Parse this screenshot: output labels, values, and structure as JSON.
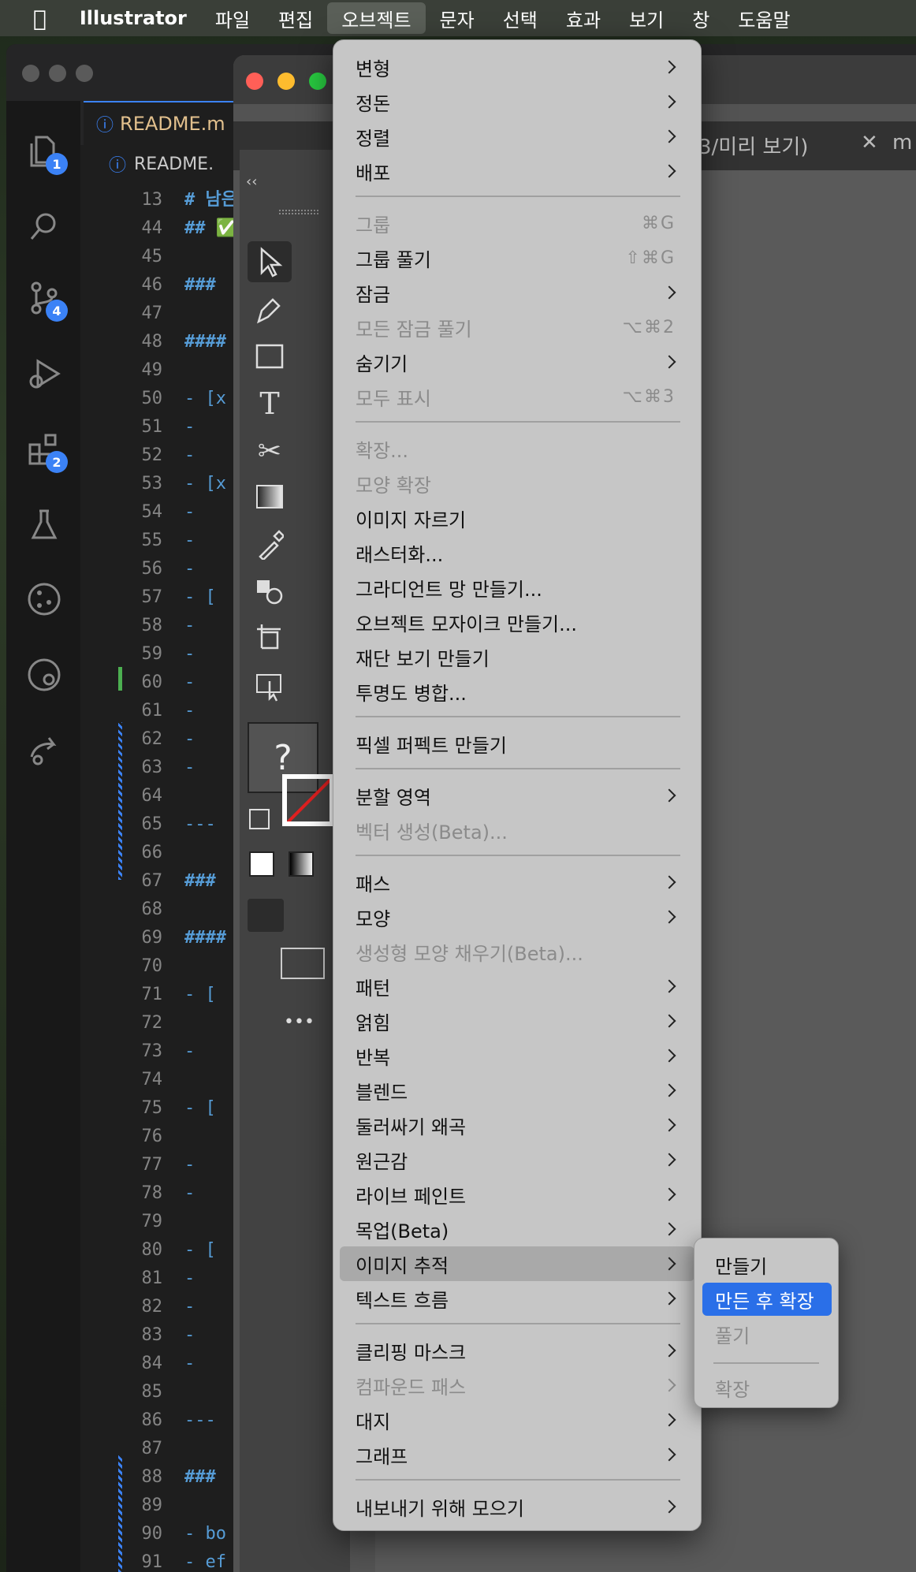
{
  "menubar": {
    "app_name": "Illustrator",
    "items": [
      "파일",
      "편집",
      "오브젝트",
      "문자",
      "선택",
      "효과",
      "보기",
      "창",
      "도움말"
    ],
    "active_index": 2
  },
  "vscode": {
    "tab_label": "README.m",
    "breadcrumb": "README.",
    "preview_tab": "3/미리 보기)",
    "close_tab": "m",
    "badges": {
      "explorer": "1",
      "scm": "4",
      "extensions": "2"
    },
    "lines": [
      {
        "n": "13",
        "t": "# 남은"
      },
      {
        "n": "44",
        "t": "## ✅"
      },
      {
        "n": "45",
        "t": ""
      },
      {
        "n": "46",
        "t": "###"
      },
      {
        "n": "47",
        "t": ""
      },
      {
        "n": "48",
        "t": "####"
      },
      {
        "n": "49",
        "t": ""
      },
      {
        "n": "50",
        "t": "- [x"
      },
      {
        "n": "51",
        "t": "  -"
      },
      {
        "n": "52",
        "t": "  -"
      },
      {
        "n": "53",
        "t": "- [x"
      },
      {
        "n": "54",
        "t": "  -"
      },
      {
        "n": "55",
        "t": "  -"
      },
      {
        "n": "56",
        "t": "  -"
      },
      {
        "n": "57",
        "t": "- ["
      },
      {
        "n": "58",
        "t": "  -"
      },
      {
        "n": "59",
        "t": "  -"
      },
      {
        "n": "60",
        "t": "  -"
      },
      {
        "n": "61",
        "t": "  -"
      },
      {
        "n": "62",
        "t": "  -"
      },
      {
        "n": "63",
        "t": "  -"
      },
      {
        "n": "64",
        "t": ""
      },
      {
        "n": "65",
        "t": "---"
      },
      {
        "n": "66",
        "t": ""
      },
      {
        "n": "67",
        "t": "###"
      },
      {
        "n": "68",
        "t": ""
      },
      {
        "n": "69",
        "t": "####"
      },
      {
        "n": "70",
        "t": ""
      },
      {
        "n": "71",
        "t": "- ["
      },
      {
        "n": "72",
        "t": ""
      },
      {
        "n": "73",
        "t": "  -"
      },
      {
        "n": "74",
        "t": ""
      },
      {
        "n": "75",
        "t": "- ["
      },
      {
        "n": "76",
        "t": ""
      },
      {
        "n": "77",
        "t": "  -"
      },
      {
        "n": "78",
        "t": "  -"
      },
      {
        "n": "79",
        "t": ""
      },
      {
        "n": "80",
        "t": "- ["
      },
      {
        "n": "81",
        "t": "  -"
      },
      {
        "n": "82",
        "t": "  -"
      },
      {
        "n": "83",
        "t": "  -"
      },
      {
        "n": "84",
        "t": "  -"
      },
      {
        "n": "85",
        "t": ""
      },
      {
        "n": "86",
        "t": "---"
      },
      {
        "n": "87",
        "t": ""
      },
      {
        "n": "88",
        "t": "###"
      },
      {
        "n": "89",
        "t": ""
      },
      {
        "n": "90",
        "t": "- bo"
      },
      {
        "n": "91",
        "t": "- ef"
      }
    ]
  },
  "illustrator": {
    "collapse_label": "‹‹",
    "unknown_swatch": "?",
    "more_label": "•••"
  },
  "object_menu": {
    "items": [
      {
        "label": "변형",
        "arrow": true
      },
      {
        "label": "정돈",
        "arrow": true
      },
      {
        "label": "정렬",
        "arrow": true
      },
      {
        "label": "배포",
        "arrow": true
      },
      {
        "sep": true
      },
      {
        "label": "그룹",
        "disabled": true,
        "shortcut": "⌘G"
      },
      {
        "label": "그룹 풀기",
        "shortcut": "⇧⌘G"
      },
      {
        "label": "잠금",
        "arrow": true
      },
      {
        "label": "모든 잠금 풀기",
        "disabled": true,
        "shortcut": "⌥⌘2"
      },
      {
        "label": "숨기기",
        "arrow": true
      },
      {
        "label": "모두 표시",
        "disabled": true,
        "shortcut": "⌥⌘3"
      },
      {
        "sep": true
      },
      {
        "label": "확장...",
        "disabled": true
      },
      {
        "label": "모양 확장",
        "disabled": true
      },
      {
        "label": "이미지 자르기"
      },
      {
        "label": "래스터화..."
      },
      {
        "label": "그라디언트 망 만들기..."
      },
      {
        "label": "오브젝트 모자이크 만들기..."
      },
      {
        "label": "재단 보기 만들기"
      },
      {
        "label": "투명도 병합..."
      },
      {
        "sep": true
      },
      {
        "label": "픽셀 퍼펙트 만들기"
      },
      {
        "sep": true
      },
      {
        "label": "분할 영역",
        "arrow": true
      },
      {
        "label": "벡터 생성(Beta)...",
        "disabled": true
      },
      {
        "sep": true
      },
      {
        "label": "패스",
        "arrow": true
      },
      {
        "label": "모양",
        "arrow": true
      },
      {
        "label": "생성형 모양 채우기(Beta)...",
        "disabled": true
      },
      {
        "label": "패턴",
        "arrow": true
      },
      {
        "label": "얽힘",
        "arrow": true
      },
      {
        "label": "반복",
        "arrow": true
      },
      {
        "label": "블렌드",
        "arrow": true
      },
      {
        "label": "둘러싸기 왜곡",
        "arrow": true
      },
      {
        "label": "원근감",
        "arrow": true
      },
      {
        "label": "라이브 페인트",
        "arrow": true
      },
      {
        "label": "목업(Beta)",
        "arrow": true
      },
      {
        "label": "이미지 추적",
        "arrow": true,
        "highlighted": true
      },
      {
        "label": "텍스트 흐름",
        "arrow": true
      },
      {
        "sep": true
      },
      {
        "label": "클리핑 마스크",
        "arrow": true
      },
      {
        "label": "컴파운드 패스",
        "arrow": true,
        "disabled": true
      },
      {
        "label": "대지",
        "arrow": true
      },
      {
        "label": "그래프",
        "arrow": true
      },
      {
        "sep": true
      },
      {
        "label": "내보내기 위해 모으기",
        "arrow": true
      }
    ]
  },
  "image_trace_submenu": {
    "items": [
      {
        "label": "만들기"
      },
      {
        "label": "만든 후 확장",
        "selected": true
      },
      {
        "label": "풀기",
        "disabled": true
      },
      {
        "sep": true
      },
      {
        "label": "확장",
        "disabled": true
      }
    ]
  }
}
